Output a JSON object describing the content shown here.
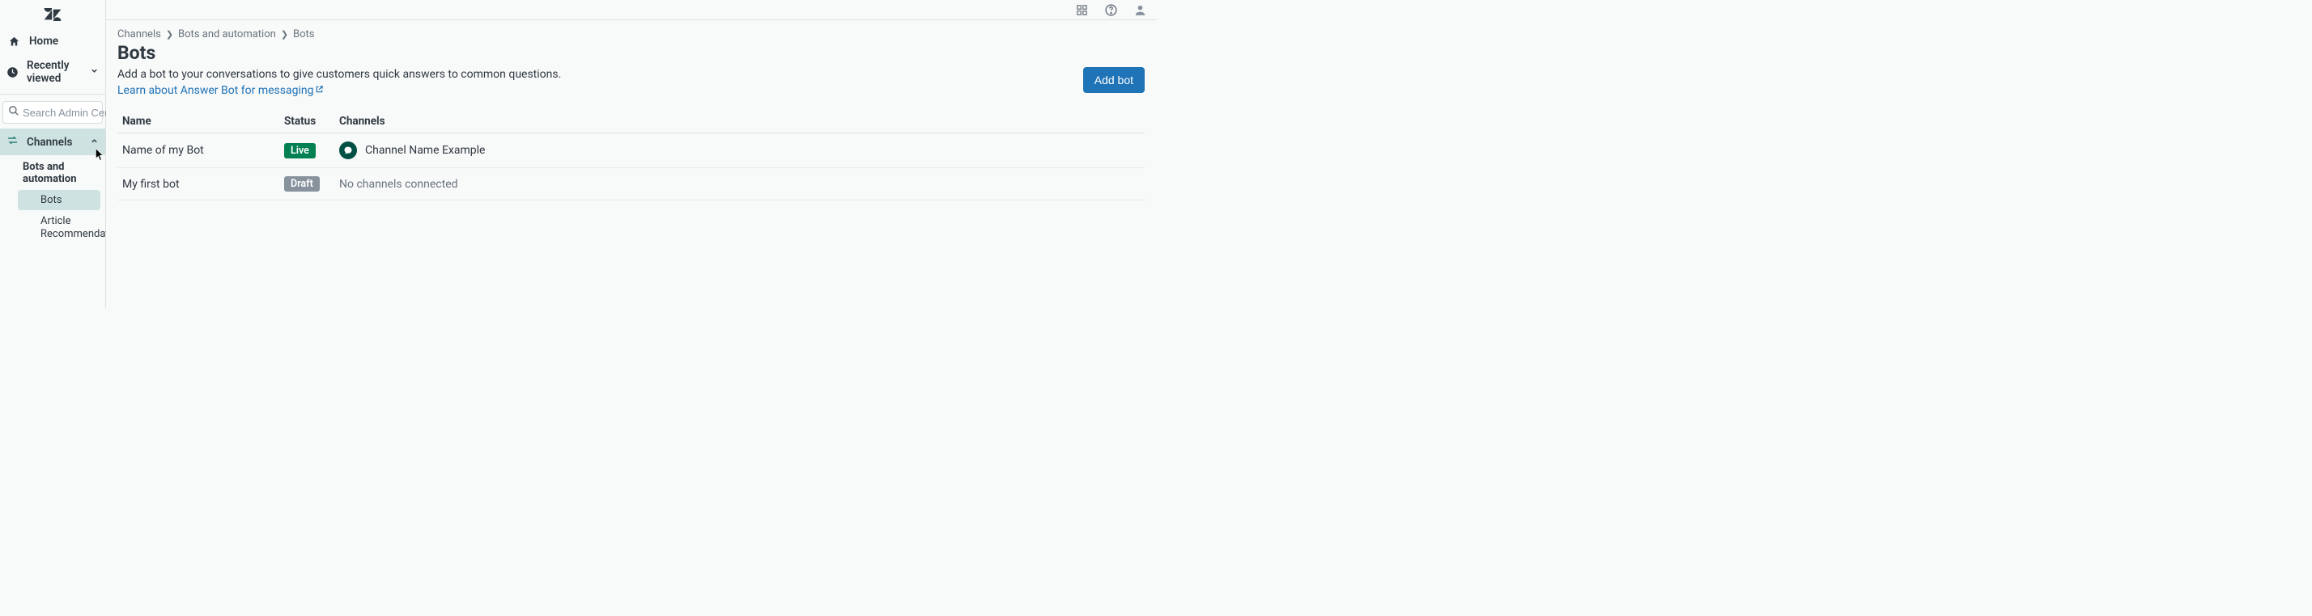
{
  "sidebar": {
    "home": "Home",
    "recently_viewed": "Recently viewed",
    "search_placeholder": "Search Admin Center",
    "channels": "Channels",
    "group_heading": "Bots and automation",
    "items": [
      "Bots",
      "Article Recommendations"
    ]
  },
  "breadcrumb": [
    "Channels",
    "Bots and automation",
    "Bots"
  ],
  "page": {
    "title": "Bots",
    "description": "Add a bot to your conversations to give customers quick answers to common questions. ",
    "learn_link": "Learn about Answer Bot for messaging",
    "add_button": "Add bot"
  },
  "table": {
    "headers": {
      "name": "Name",
      "status": "Status",
      "channels": "Channels"
    },
    "rows": [
      {
        "name": "Name of my Bot",
        "status": "Live",
        "status_kind": "live",
        "channel": "Channel Name Example",
        "has_channel": true
      },
      {
        "name": "My first bot",
        "status": "Draft",
        "status_kind": "draft",
        "channel": "No channels connected",
        "has_channel": false
      }
    ]
  }
}
